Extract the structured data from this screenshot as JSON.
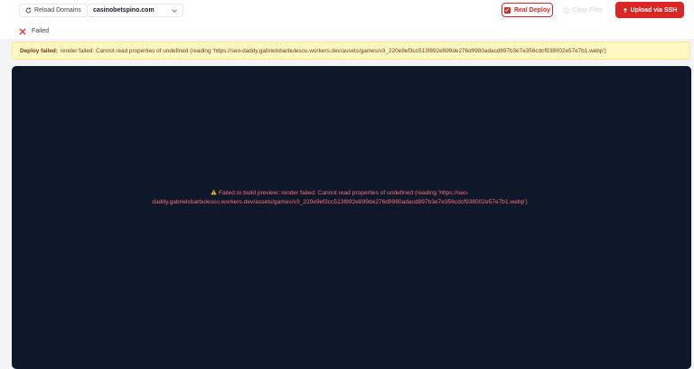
{
  "toolbar": {
    "reload_label": "Reload Domains",
    "domain_selected": "casinobetspino.com",
    "real_deploy_label": "Real Deploy",
    "clear_files_label": "Clear Files",
    "upload_ssh_label": "Upload via SSH"
  },
  "status": {
    "label": "Failed",
    "color": "#dc2626"
  },
  "banner": {
    "prefix": "Deploy failed:",
    "message": "render failed: Cannot read properties of undefined (reading 'https://seo-daddy.gabrielxbarbulescu.workers.dev/assets/games/v3_220e9ef3cc513f892e899de276d9980adacd897b3e7e356cdcf938002e57e7b1.webp')"
  },
  "preview": {
    "error_line1": "Failed to build preview: render failed: Cannot read properties of undefined (reading 'https://seo-",
    "error_line2": "daddy.gabrielxbarbulescu.workers.dev/assets/games/v3_220e9ef3cc513f892e899de276d9980adacd897b3e7e356cdcf938002e57e7b1.webp')"
  },
  "colors": {
    "accent": "#dc2626",
    "preview_bg": "#0f172a",
    "banner_bg": "#fef9c3"
  }
}
